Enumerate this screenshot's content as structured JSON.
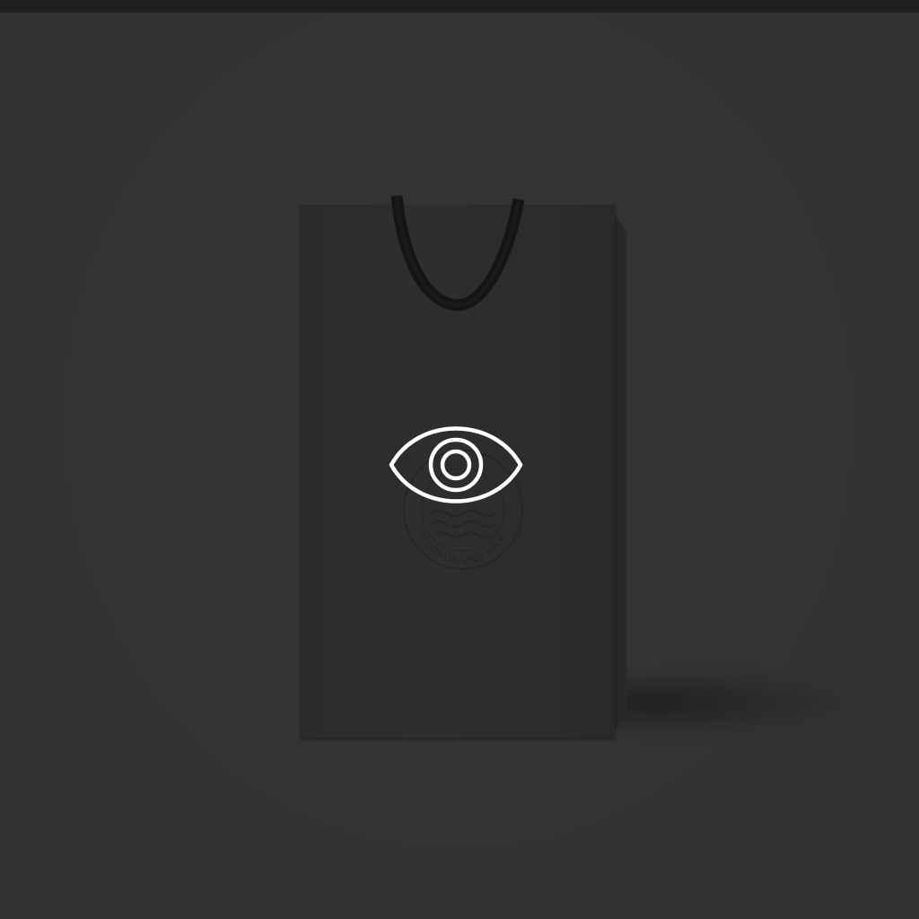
{
  "scene": {
    "object": "shopping-bag",
    "colors": {
      "background": "#333333",
      "top_bar": "#1e1e1e",
      "bag": "#2d2d2d",
      "handle": "#1a1a1a",
      "logo": "#ffffff"
    },
    "icons": {
      "logo": "eye-icon",
      "embossed": "circular-stamp-seal"
    },
    "stamp_text": "MOCKUP PSD FILE"
  }
}
